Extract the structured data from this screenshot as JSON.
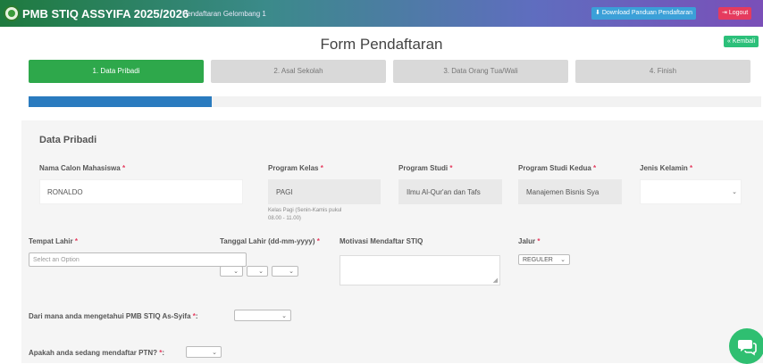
{
  "header": {
    "title": "PMB STIQ ASSYIFA 2025/2026",
    "subtitle": "Pendaftaran Gelombang 1",
    "download_label": "Download Panduan Pendaftaran",
    "logout_label": "Logout"
  },
  "form_title": "Form Pendaftaran",
  "back_label": "« Kembali",
  "steps": [
    {
      "label": "1. Data Pribadi"
    },
    {
      "label": "2. Asal Sekolah"
    },
    {
      "label": "3. Data Orang Tua/Wali"
    },
    {
      "label": "4. Finish"
    }
  ],
  "progress": {
    "value": 0.25
  },
  "section": {
    "title": "Data Pribadi"
  },
  "fields": {
    "nama": {
      "label": "Nama Calon Mahasiswa",
      "value": "RONALDO"
    },
    "program_kelas": {
      "label": "Program Kelas",
      "value": "PAGI",
      "hint": "Kelas Pagi (Senin-Kamis pukul 08.00 - 11.00)"
    },
    "program_studi": {
      "label": "Program Studi",
      "value": "Ilmu Al-Qur'an dan Tafs"
    },
    "program_studi_kedua": {
      "label": "Program Studi Kedua",
      "value": "Manajemen Bisnis Sya"
    },
    "jenis_kelamin": {
      "label": "Jenis Kelamin",
      "value": ""
    },
    "tempat_lahir": {
      "label": "Tempat Lahir",
      "placeholder": "Select an Option"
    },
    "tanggal_lahir": {
      "label": "Tanggal Lahir (dd-mm-yyyy)"
    },
    "motivasi": {
      "label": "Motivasi Mendaftar STIQ"
    },
    "jalur": {
      "label": "Jalur",
      "value": "REGULER"
    },
    "sumber_info": {
      "label": "Dari mana anda mengetahui PMB STIQ As-Syifa",
      "value": ""
    },
    "ptn": {
      "label": "Apakah anda sedang mendaftar PTN?",
      "value": ""
    }
  },
  "required_mark": "*",
  "colors": {
    "step_active": "#2ea84b",
    "progress": "#2a7bbf",
    "logout": "#e53b5e",
    "download": "#3ba0d8",
    "chat": "#2fbf71"
  },
  "icons": {
    "logo": "logo-icon",
    "download": "download-icon",
    "logout": "logout-icon",
    "chat": "chat-icon",
    "dropdown": "chevron-down-icon"
  }
}
